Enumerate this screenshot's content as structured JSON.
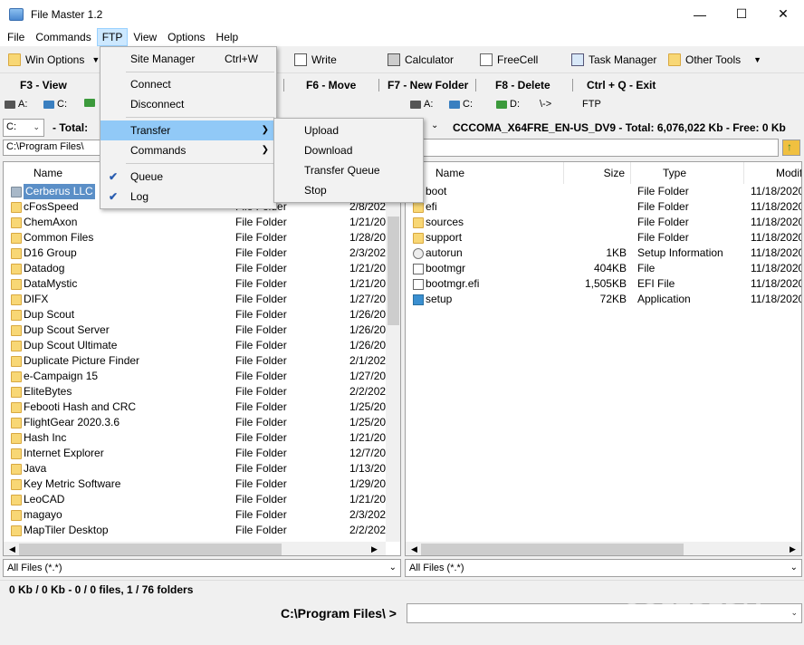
{
  "window": {
    "title": "File Master 1.2",
    "min": "—",
    "max": "☐",
    "close": "✕"
  },
  "menubar": [
    "File",
    "Commands",
    "FTP",
    "View",
    "Options",
    "Help"
  ],
  "toolbar": {
    "win_options": "Win Options",
    "write": "Write",
    "calculator": "Calculator",
    "freecell": "FreeCell",
    "task_manager": "Task Manager",
    "other_tools": "Other Tools"
  },
  "fkeys": {
    "f3": "F3 - View",
    "f6": "F6 - Move",
    "f7": "F7 - New Folder",
    "f8": "F8 - Delete",
    "exit": "Ctrl + Q - Exit"
  },
  "left": {
    "drives": [
      "A:",
      "C:"
    ],
    "drive_select": "C:",
    "total_label": "- Total: ",
    "path": "C:\\Program Files\\",
    "col_name": "Name",
    "rows": [
      {
        "name": "Cerberus LLC",
        "type": "File Folder",
        "date": "1/21/20"
      },
      {
        "name": "cFosSpeed",
        "type": "File Folder",
        "date": "2/8/202"
      },
      {
        "name": "ChemAxon",
        "type": "File Folder",
        "date": "1/21/20"
      },
      {
        "name": "Common Files",
        "type": "File Folder",
        "date": "1/28/20"
      },
      {
        "name": "D16 Group",
        "type": "File Folder",
        "date": "2/3/202"
      },
      {
        "name": "Datadog",
        "type": "File Folder",
        "date": "1/21/20"
      },
      {
        "name": "DataMystic",
        "type": "File Folder",
        "date": "1/21/20"
      },
      {
        "name": "DIFX",
        "type": "File Folder",
        "date": "1/27/20"
      },
      {
        "name": "Dup Scout",
        "type": "File Folder",
        "date": "1/26/20"
      },
      {
        "name": "Dup Scout Server",
        "type": "File Folder",
        "date": "1/26/20"
      },
      {
        "name": "Dup Scout Ultimate",
        "type": "File Folder",
        "date": "1/26/20"
      },
      {
        "name": "Duplicate Picture Finder",
        "type": "File Folder",
        "date": "2/1/202"
      },
      {
        "name": "e-Campaign 15",
        "type": "File Folder",
        "date": "1/27/20"
      },
      {
        "name": "EliteBytes",
        "type": "File Folder",
        "date": "2/2/202"
      },
      {
        "name": "Febooti Hash and CRC",
        "type": "File Folder",
        "date": "1/25/20"
      },
      {
        "name": "FlightGear 2020.3.6",
        "type": "File Folder",
        "date": "1/25/20"
      },
      {
        "name": "Hash Inc",
        "type": "File Folder",
        "date": "1/21/20"
      },
      {
        "name": "Internet Explorer",
        "type": "File Folder",
        "date": "12/7/20"
      },
      {
        "name": "Java",
        "type": "File Folder",
        "date": "1/13/20"
      },
      {
        "name": "Key Metric Software",
        "type": "File Folder",
        "date": "1/29/20"
      },
      {
        "name": "LeoCAD",
        "type": "File Folder",
        "date": "1/21/20"
      },
      {
        "name": "magayo",
        "type": "File Folder",
        "date": "2/3/202"
      },
      {
        "name": "MapTiler Desktop",
        "type": "File Folder",
        "date": "2/2/202"
      }
    ],
    "filter": "All Files (*.*)",
    "status": "0 Kb / 0 Kb - 0 / 0 files, 1 / 76 folders"
  },
  "right": {
    "drives": [
      "A:",
      "C:",
      "D:",
      "\\->",
      "FTP"
    ],
    "volume_info": "CCCOMA_X64FRE_EN-US_DV9 - Total: 6,076,022 Kb - Free: 0 Kb",
    "path": "",
    "cols": {
      "name": "Name",
      "size": "Size",
      "type": "Type",
      "modified": "Modifi"
    },
    "rows": [
      {
        "name": "boot",
        "size": "",
        "type": "File Folder",
        "date": "11/18/2020",
        "icon": "folder"
      },
      {
        "name": "efi",
        "size": "",
        "type": "File Folder",
        "date": "11/18/2020",
        "icon": "folder"
      },
      {
        "name": "sources",
        "size": "",
        "type": "File Folder",
        "date": "11/18/2020",
        "icon": "folder"
      },
      {
        "name": "support",
        "size": "",
        "type": "File Folder",
        "date": "11/18/2020",
        "icon": "folder"
      },
      {
        "name": "autorun",
        "size": "1KB",
        "type": "Setup Information",
        "date": "11/18/2020",
        "icon": "gear"
      },
      {
        "name": "bootmgr",
        "size": "404KB",
        "type": "File",
        "date": "11/18/2020",
        "icon": "doc"
      },
      {
        "name": "bootmgr.efi",
        "size": "1,505KB",
        "type": "EFI File",
        "date": "11/18/2020",
        "icon": "doc"
      },
      {
        "name": "setup",
        "size": "72KB",
        "type": "Application",
        "date": "11/18/2020",
        "icon": "app"
      }
    ],
    "filter": "All Files (*.*)"
  },
  "bottom": {
    "path_label": "C:\\Program Files\\ >"
  },
  "ftp_menu": {
    "site_manager": "Site Manager",
    "site_manager_sc": "Ctrl+W",
    "connect": "Connect",
    "disconnect": "Disconnect",
    "transfer": "Transfer",
    "commands": "Commands",
    "queue": "Queue",
    "log": "Log"
  },
  "transfer_menu": [
    "Upload",
    "Download",
    "Transfer Queue",
    "Stop"
  ],
  "watermark": "SOFTPEDIA"
}
